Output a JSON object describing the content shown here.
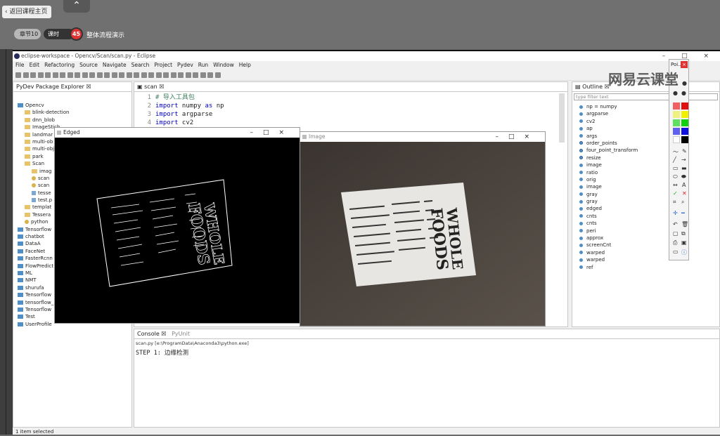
{
  "course": {
    "back_label": "返回课程主页",
    "collapse_glyph": "⌃",
    "chapter_label": "章节10",
    "lesson_label": "课时",
    "lesson_number": "45",
    "lesson_title": "整体流程演示"
  },
  "window": {
    "title": "eclipse-workspace - Opencv/Scan/scan.py - Eclipse",
    "controls": "–  □  ×"
  },
  "menu": [
    "File",
    "Edit",
    "Refactoring",
    "Source",
    "Navigate",
    "Search",
    "Project",
    "Pydev",
    "Run",
    "Window",
    "Help"
  ],
  "package_explorer": {
    "title": "PyDev Package Explorer",
    "items": [
      {
        "label": "Opencv",
        "kind": "proj",
        "indent": 0
      },
      {
        "label": "blink-detection",
        "kind": "folder",
        "indent": 1
      },
      {
        "label": "dnn_blob",
        "kind": "folder",
        "indent": 1
      },
      {
        "label": "ImageStich",
        "kind": "folder",
        "indent": 1
      },
      {
        "label": "landmar",
        "kind": "folder",
        "indent": 1
      },
      {
        "label": "multi-ob",
        "kind": "folder",
        "indent": 1
      },
      {
        "label": "multi-obj",
        "kind": "folder",
        "indent": 1
      },
      {
        "label": "park",
        "kind": "folder",
        "indent": 1
      },
      {
        "label": "Scan",
        "kind": "folder",
        "indent": 1
      },
      {
        "label": "imag",
        "kind": "folder",
        "indent": 2
      },
      {
        "label": "scan",
        "kind": "pyfile",
        "indent": 2
      },
      {
        "label": "scan",
        "kind": "pyfile",
        "indent": 2
      },
      {
        "label": "tesse",
        "kind": "file",
        "indent": 2
      },
      {
        "label": "test.p",
        "kind": "file",
        "indent": 2
      },
      {
        "label": "templat",
        "kind": "folder",
        "indent": 1
      },
      {
        "label": "Tessera",
        "kind": "folder",
        "indent": 1
      },
      {
        "label": "python",
        "kind": "pyfile",
        "indent": 1
      },
      {
        "label": "Tensorflow",
        "kind": "proj",
        "indent": 0
      },
      {
        "label": "chatbot",
        "kind": "proj",
        "indent": 0
      },
      {
        "label": "DataA",
        "kind": "proj",
        "indent": 0
      },
      {
        "label": "FaceNet",
        "kind": "proj",
        "indent": 0
      },
      {
        "label": "FasterRcnn",
        "kind": "proj",
        "indent": 0
      },
      {
        "label": "FlowPredict",
        "kind": "proj",
        "indent": 0
      },
      {
        "label": "ML",
        "kind": "proj",
        "indent": 0
      },
      {
        "label": "NMT",
        "kind": "proj",
        "indent": 0
      },
      {
        "label": "shurufa",
        "kind": "proj",
        "indent": 0
      },
      {
        "label": "Tensorflow",
        "kind": "proj",
        "indent": 0
      },
      {
        "label": "tensorflow_",
        "kind": "proj",
        "indent": 0
      },
      {
        "label": "Tensorflow",
        "kind": "proj",
        "indent": 0
      },
      {
        "label": "Test",
        "kind": "proj",
        "indent": 0
      },
      {
        "label": "UserProfile",
        "kind": "proj",
        "indent": 0
      }
    ]
  },
  "editor": {
    "tab": "scan",
    "lines": [
      {
        "n": "1",
        "code": "# 导入工具包",
        "type": "comment"
      },
      {
        "n": "2",
        "kw": "import",
        "rest": " numpy ",
        "kw2": "as",
        "rest2": " np"
      },
      {
        "n": "3",
        "kw": "import",
        "rest": " argparse"
      },
      {
        "n": "4",
        "kw": "import",
        "rest": " cv2"
      }
    ]
  },
  "outline": {
    "title": "Outline",
    "filter_placeholder": "type filter text",
    "items": [
      "np = numpy",
      "argparse",
      "cv2",
      "ap",
      "args",
      "order_points",
      "four_point_transform",
      "resize",
      "image",
      "ratio",
      "orig",
      "image",
      "gray",
      "gray",
      "edged",
      "cnts",
      "cnts",
      "peri",
      "approx",
      "screenCnt",
      "warped",
      "warped",
      "ref"
    ]
  },
  "edged_window": {
    "title": "Edged"
  },
  "image_window": {
    "title": "Image"
  },
  "palette": {
    "title": "Poi..."
  },
  "receipt": {
    "brand_line1": "WHOLE",
    "brand_line2": "FOODS"
  },
  "console": {
    "tab": "Console",
    "tab2": "PyUnit",
    "path": "scan.py [e:\\ProgramData\\Anaconda3\\python.exe]",
    "output": "STEP 1: 边缘检测"
  },
  "status": "1 item selected",
  "watermark": "网易云课堂"
}
